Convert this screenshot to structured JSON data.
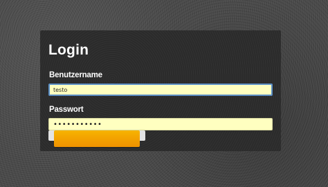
{
  "form": {
    "title": "Login",
    "username_label": "Benutzername",
    "username_value": "testo",
    "password_label": "Passwort",
    "password_value": "•••••••••••"
  },
  "colors": {
    "input_background": "#ffffc0",
    "focus_border": "#5b8fc7",
    "button_accent": "#f3a300"
  }
}
